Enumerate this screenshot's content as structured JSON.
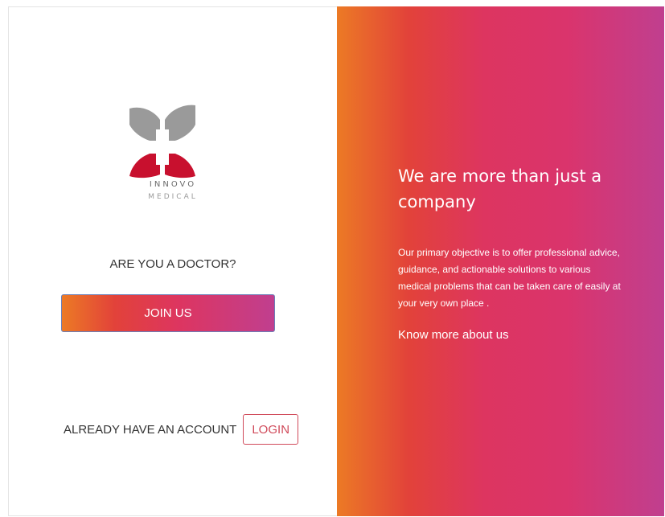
{
  "brand": {
    "name": "INNOVO",
    "sub": "MEDICAL"
  },
  "left": {
    "doctor_question": "ARE YOU A DOCTOR?",
    "join_label": "JOIN US",
    "account_text": "ALREADY HAVE AN ACCOUNT",
    "login_label": "LOGIN"
  },
  "right": {
    "headline": "We are more than just a company",
    "description": "Our primary objective is to offer professional advice, guidance, and actionable solutions to various medical problems that can be taken care of easily at your very own place .",
    "know_more": "Know more about us"
  },
  "colors": {
    "gradient_start": "#ec7a25",
    "gradient_mid": "#dd3560",
    "gradient_end": "#c03f8f",
    "logo_gray": "#9a9a9a",
    "logo_red": "#c8102e",
    "login_accent": "#d04a5a"
  },
  "icons": {
    "logo": "innovo-medical-cross-logo"
  }
}
